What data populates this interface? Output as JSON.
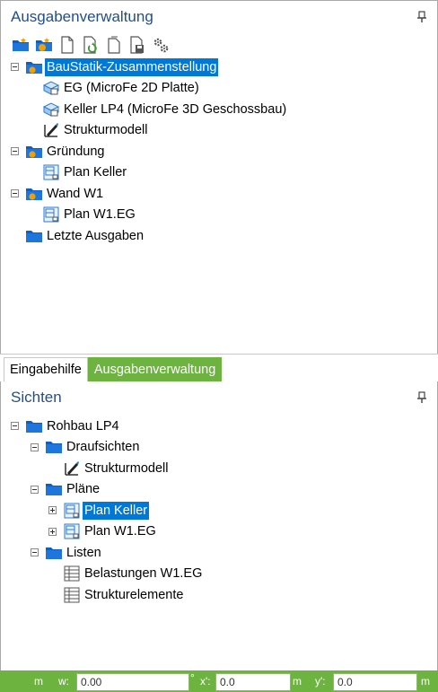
{
  "top_panel": {
    "title": "Ausgabenverwaltung",
    "toolbar": [
      "new-folder-icon",
      "new-auto-folder-icon",
      "new-document-icon",
      "refresh-document-icon",
      "blank-document-icon",
      "save-document-icon",
      "settings-icon"
    ],
    "tree": {
      "n0": "BauStatik-Zusammenstellung",
      "n1": "EG (MicroFe 2D Platte)",
      "n2": "Keller LP4 (MicroFe 3D Geschossbau)",
      "n3": "Strukturmodell",
      "n4": "Gründung",
      "n5": "Plan Keller",
      "n6": "Wand W1",
      "n7": "Plan W1.EG",
      "n8": "Letzte Ausgaben"
    }
  },
  "tabs": {
    "t0": "Eingabehilfe",
    "t1": "Ausgabenverwaltung"
  },
  "bottom_panel": {
    "title": "Sichten",
    "tree": {
      "n0": "Rohbau LP4",
      "n1": "Draufsichten",
      "n2": "Strukturmodell",
      "n3": "Pläne",
      "n4": "Plan Keller",
      "n5": "Plan W1.EG",
      "n6": "Listen",
      "n7": "Belastungen W1.EG",
      "n8": "Strukturelemente"
    }
  },
  "status": {
    "unit_m1": "m",
    "w_label": "w:",
    "w_value": "0.00",
    "deg": "°",
    "x_label": "x':",
    "x_value": "0.0",
    "unit_m2": "m",
    "y_label": "y':",
    "y_value": "0.0",
    "unit_m3": "m"
  },
  "colors": {
    "accent_green": "#6db33f",
    "selection_blue": "#0078d7",
    "title_blue": "#1f4f8e",
    "folder_blue": "#0a5fc8",
    "folder_orange": "#f0a000"
  }
}
